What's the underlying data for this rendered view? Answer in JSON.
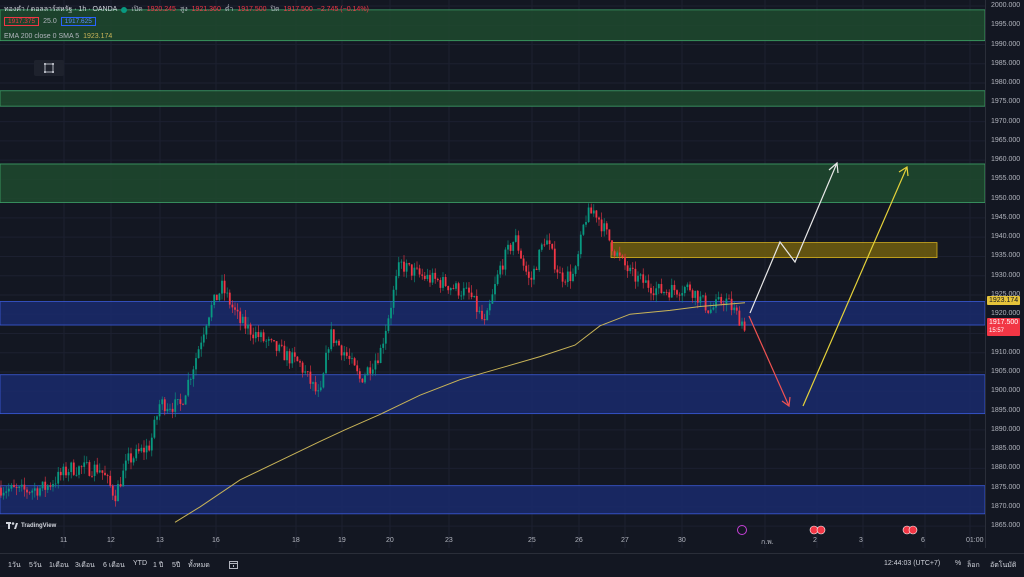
{
  "header": {
    "symbol_title": "ทองคำ / ดอลลาร์สหรัฐ · 1h · OANDA",
    "ohlc": [
      {
        "label": "เปิด",
        "value": "1920.245"
      },
      {
        "label": "สูง",
        "value": "1921.360"
      },
      {
        "label": "ต่ำ",
        "value": "1917.500"
      },
      {
        "label": "ปิด",
        "value": "1917.500"
      }
    ],
    "change": "−2.745 (−0.14%)",
    "bid": "1917.375",
    "spread": "25.0",
    "ask": "1917.625",
    "indicator_label": "EMA 200 close 0 SMA 5",
    "indicator_value": "1923.174"
  },
  "price_axis": {
    "ticks": [
      "2000.000",
      "1995.000",
      "1990.000",
      "1985.000",
      "1980.000",
      "1975.000",
      "1970.000",
      "1965.000",
      "1960.000",
      "1955.000",
      "1950.000",
      "1945.000",
      "1940.000",
      "1935.000",
      "1930.000",
      "1925.000",
      "1920.000",
      "1915.000",
      "1910.000",
      "1905.000",
      "1900.000",
      "1895.000",
      "1890.000",
      "1885.000",
      "1880.000",
      "1875.000",
      "1870.000",
      "1865.000"
    ],
    "ema_tag": "1923.174",
    "price_tag": "1917.500",
    "countdown": "15:57"
  },
  "time_axis": {
    "ticks": [
      "11",
      "12",
      "13",
      "16",
      "18",
      "19",
      "20",
      "23",
      "25",
      "26",
      "27",
      "30",
      "ก.พ.",
      "2",
      "3",
      "6",
      "01:00"
    ]
  },
  "bottom_bar": {
    "ranges": [
      "1วัน",
      "5วัน",
      "1เดือน",
      "3เดือน",
      "6 เดือน",
      "YTD",
      "1 ปี",
      "5ปี",
      "ทั้งหมด"
    ],
    "clock": "12:44:03 (UTC+7)",
    "percent": "%",
    "log": "ล็อก",
    "auto": "อัตโนมัติ"
  },
  "watermark": "TradingView",
  "colors": {
    "background": "#131722",
    "bull": "#089981",
    "bear": "#f23645",
    "ema": "#c9b458",
    "green_zone": "#1e4a2e",
    "blue_zone": "#1a2a6c",
    "yellow_zone": "#6b5a10"
  }
}
